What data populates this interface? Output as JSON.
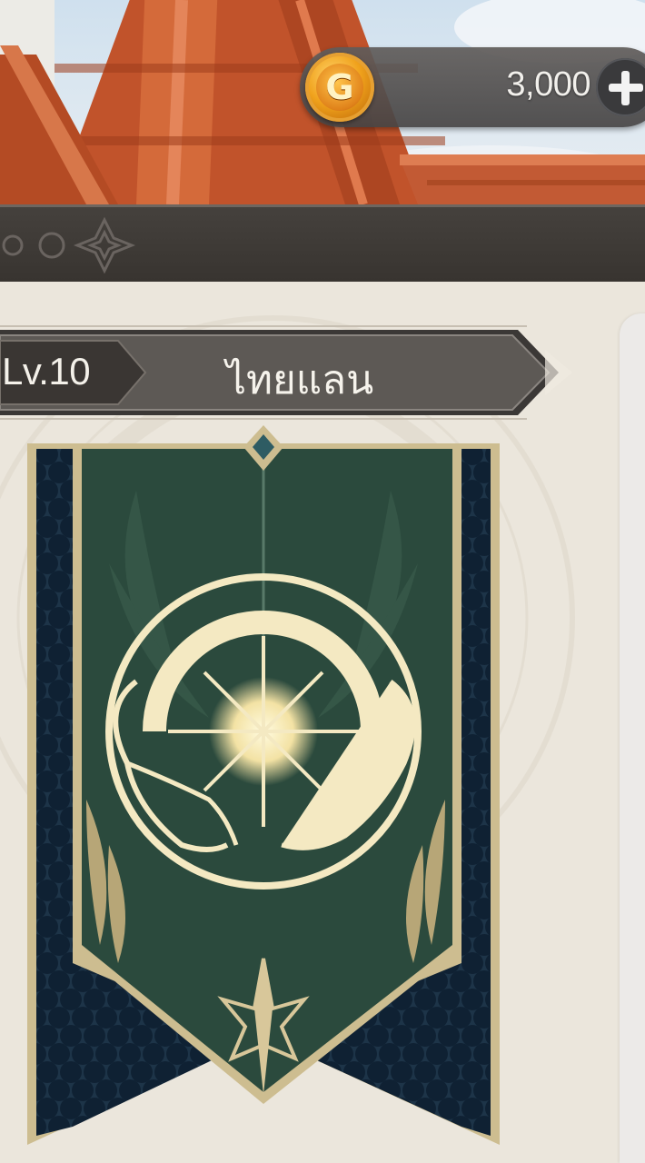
{
  "currency": {
    "icon": "gold-coin-icon",
    "coin_letter": "G",
    "amount": "3,000",
    "add_icon": "plus-icon"
  },
  "guild": {
    "level": "Lv.10",
    "name": "ไทยแลน",
    "emblem_icon": "sun-cats-emblem",
    "colors": {
      "banner": "#2b4a3d",
      "trim": "#d8c79a",
      "side_pattern": "#13273a"
    }
  }
}
